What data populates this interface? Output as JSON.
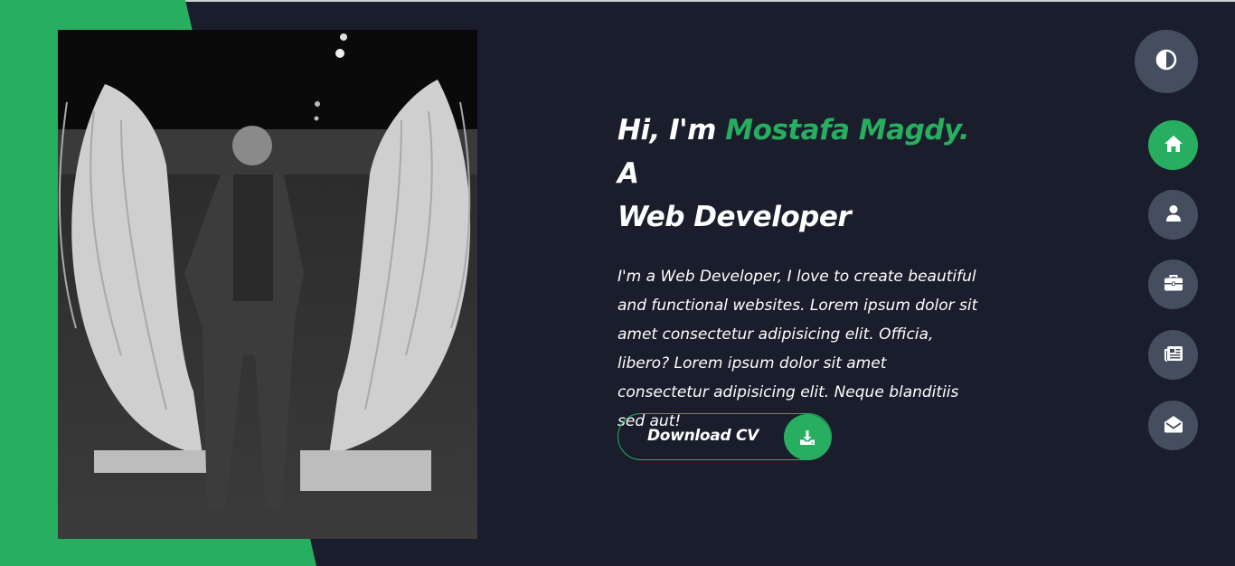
{
  "hero": {
    "greeting": "Hi, I'm ",
    "name": "Mostafa Magdy.",
    "role_prefix": " A",
    "role": "Web Developer",
    "description": "I'm a Web Developer, I love to create beautiful and functional websites. Lorem ipsum dolor sit amet consectetur adipisicing elit. Officia, libero? Lorem ipsum dolor sit amet consectetur adipisicing elit. Neque blanditiis sed aut!",
    "cv_button_label": "Download CV",
    "cv_icon": "download-icon"
  },
  "controls": {
    "theme_toggle_icon": "contrast-icon"
  },
  "nav": {
    "items": [
      {
        "icon": "home-icon",
        "active": true
      },
      {
        "icon": "user-icon",
        "active": false
      },
      {
        "icon": "briefcase-icon",
        "active": false
      },
      {
        "icon": "newspaper-icon",
        "active": false
      },
      {
        "icon": "envelope-open-icon",
        "active": false
      }
    ]
  },
  "colors": {
    "background": "#1a1d2b",
    "accent": "#27ae60",
    "control_bg": "#454e5e",
    "text": "#ffffff"
  }
}
